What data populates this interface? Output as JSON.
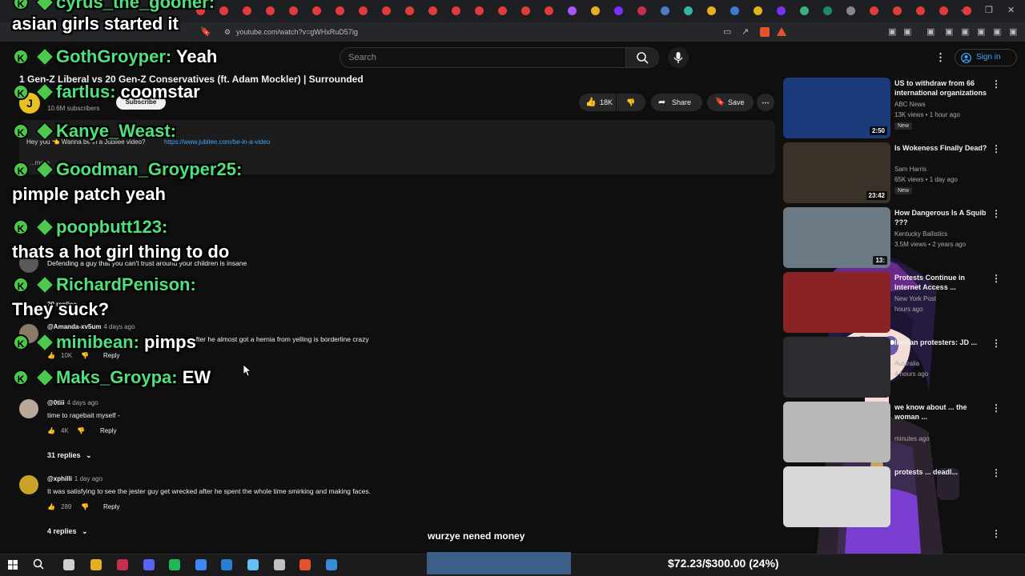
{
  "browser": {
    "url": "youtube.com/watch?v=gWHxRuD57ig"
  },
  "youtube": {
    "search_placeholder": "Search",
    "sign_in_label": "Sign in",
    "video_title": "1 Gen-Z Liberal vs 20 Gen-Z Conservatives (ft. Adam Mockler) | Surrounded",
    "channel_avatar_letter": "J",
    "channel_subs": "10.6M subscribers",
    "subscribe_label": "Subscribe",
    "likes": "18K",
    "share_label": "Share",
    "save_label": "Save",
    "desc_text": "Hey you 👈 Wanna be in a Jubilee video?",
    "desc_link": "https://www.jubilee.com/be-in-a-video",
    "desc_more": "...more"
  },
  "comments": [
    {
      "text": "Defending a guy that you can't trust around your children is insane",
      "replies": "20 replies"
    },
    {
      "handle": "@Amanda-xv5um",
      "time": "4 days ago",
      "text": "after he almost got a hernia from yelling is borderline crazy",
      "likes": "10K",
      "reply_label": "Reply"
    },
    {
      "handle": "@0tiii",
      "time": "4 days ago",
      "text": "time to ragebait myself -",
      "likes": "4K",
      "reply_label": "Reply",
      "replies": "31 replies"
    },
    {
      "handle": "@xphilli",
      "time": "1 day ago",
      "text": "It was satisfying to see the jester guy get wrecked after he spent the whole time smirking and making faces.",
      "likes": "289",
      "reply_label": "Reply",
      "replies": "4 replies"
    }
  ],
  "chat": [
    {
      "user": "cyrus_the_gooner:",
      "message": ""
    },
    {
      "user": "",
      "message": "asian girls started it"
    },
    {
      "user": "GothGroyper:",
      "message": "Yeah"
    },
    {
      "user": "fartlus:",
      "message": "coomstar"
    },
    {
      "user": "Kanye_Weast:",
      "message": ""
    },
    {
      "user": "Goodman_Groyper25:",
      "message": ""
    },
    {
      "user": "",
      "message": "pimple patch yeah"
    },
    {
      "user": "poopbutt123:",
      "message": ""
    },
    {
      "user": "",
      "message": "thats a hot girl thing to do"
    },
    {
      "user": "RichardPenison:",
      "message": ""
    },
    {
      "user": "",
      "message": "They suck?"
    },
    {
      "user": "minibean:",
      "message": "pimps"
    },
    {
      "user": "Maks_Groypa:",
      "message": "EW"
    }
  ],
  "sidebar": [
    {
      "title": "US to withdraw from 66 international organizations",
      "channel": "ABC News",
      "meta": "13K views • 1 hour ago",
      "badge": "New",
      "duration": "2:50",
      "thumb_color": "#1a3a7a"
    },
    {
      "title": "Is Wokeness Finally Dead?",
      "channel": "Sam Harris",
      "meta": "65K views • 1 day ago",
      "badge": "New",
      "duration": "23:42",
      "thumb_color": "#3a3228"
    },
    {
      "title": "How Dangerous Is A Squib ???",
      "channel": "Kentucky Ballistics",
      "meta": "3.5M views • 2 years ago",
      "duration": "13:",
      "thumb_color": "#6b7a84"
    },
    {
      "title": "Protests Continue in Internet Access ...",
      "channel": "New York Post",
      "meta": "hours ago",
      "thumb_color": "#8a2424"
    },
    {
      "title": "Iranian protesters: JD ...",
      "channel": "Australia",
      "meta": "4 hours ago",
      "thumb_color": "#2b2b30"
    },
    {
      "title": "we know about ... the woman ...",
      "channel": "",
      "meta": "minutes ago",
      "thumb_color": "#b8b8b8"
    },
    {
      "title": "protests ... deadl...",
      "channel": "",
      "meta": "",
      "thumb_color": "#d8d8d8"
    }
  ],
  "stream_overlay": {
    "caption": "wurzye nened money",
    "goal_text": "$72.23/$300.00 (24%)",
    "goal_fraction": 0.24
  },
  "colors": {
    "chat_name": "#50e07a",
    "youtube_bg": "#0f0f0f",
    "goal_bar": "#3b5f86"
  }
}
